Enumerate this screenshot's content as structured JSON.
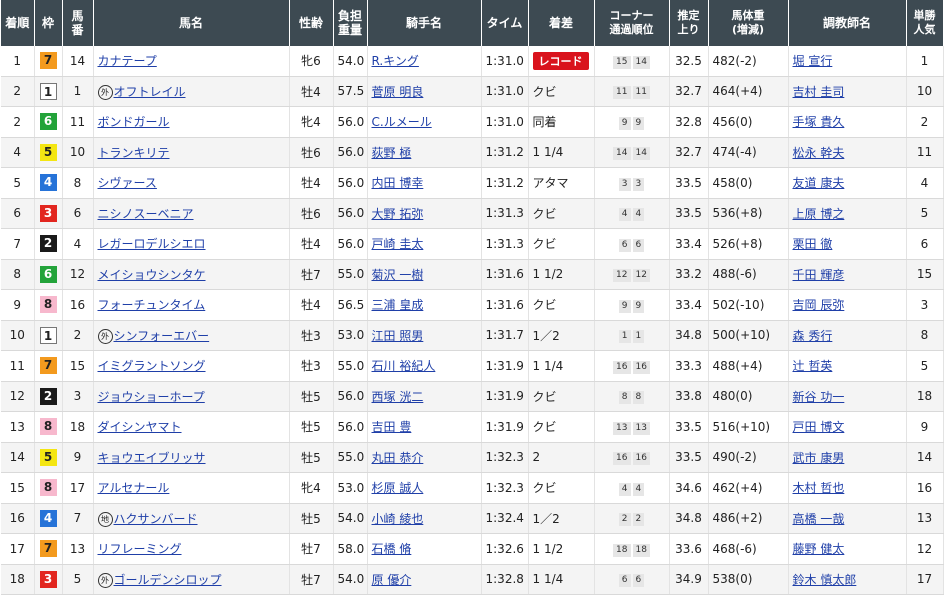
{
  "headers": {
    "rank": "着順",
    "waku": "枠",
    "umaban": "馬番",
    "horse": "馬名",
    "sexage": "性齢",
    "weight": "負担重量",
    "jockey": "騎手名",
    "time": "タイム",
    "margin": "着差",
    "corner": "コーナー通過順位",
    "last": "推定上り",
    "bodyweight": "馬体重(増減)",
    "trainer": "調教師名",
    "pop": "単勝人気"
  },
  "header_lines": {
    "umaban": [
      "馬",
      "番"
    ],
    "weight": [
      "負担",
      "重量"
    ],
    "corner": [
      "コーナー",
      "通過順位"
    ],
    "last": [
      "推定",
      "上り"
    ],
    "bodyweight": [
      "馬体重",
      "(増減)"
    ],
    "pop": [
      "単勝",
      "人気"
    ]
  },
  "colors": {
    "header_bg": "#3d4a52",
    "link": "#1f3fa8",
    "record_badge": "#d9131d"
  },
  "rows": [
    {
      "rank": "1",
      "waku": "7",
      "umaban": "14",
      "mark": "",
      "horse": "カナテープ",
      "sexage": "牝6",
      "weight": "54.0",
      "jockey": "R.キング",
      "time": "1:31.0",
      "margin": "",
      "badge": "レコード",
      "c1": "15",
      "c2": "14",
      "last": "32.5",
      "bw": "482",
      "chg": "(-2)",
      "trainer": "堀 宣行",
      "pop": "1"
    },
    {
      "rank": "2",
      "waku": "1",
      "umaban": "1",
      "mark": "外",
      "horse": "オフトレイル",
      "sexage": "牡4",
      "weight": "57.5",
      "jockey": "菅原 明良",
      "time": "1:31.0",
      "margin": "クビ",
      "badge": "",
      "c1": "11",
      "c2": "11",
      "last": "32.7",
      "bw": "464",
      "chg": "(+4)",
      "trainer": "吉村 圭司",
      "pop": "10"
    },
    {
      "rank": "2",
      "waku": "6",
      "umaban": "11",
      "mark": "",
      "horse": "ボンドガール",
      "sexage": "牝4",
      "weight": "56.0",
      "jockey": "C.ルメール",
      "time": "1:31.0",
      "margin": "同着",
      "badge": "",
      "c1": "9",
      "c2": "9",
      "last": "32.8",
      "bw": "456",
      "chg": "(0)",
      "trainer": "手塚 貴久",
      "pop": "2"
    },
    {
      "rank": "4",
      "waku": "5",
      "umaban": "10",
      "mark": "",
      "horse": "トランキリテ",
      "sexage": "牡6",
      "weight": "56.0",
      "jockey": "荻野 極",
      "time": "1:31.2",
      "margin": "1 1/4",
      "badge": "",
      "c1": "14",
      "c2": "14",
      "last": "32.7",
      "bw": "474",
      "chg": "(-4)",
      "trainer": "松永 幹夫",
      "pop": "11"
    },
    {
      "rank": "5",
      "waku": "4",
      "umaban": "8",
      "mark": "",
      "horse": "シヴァース",
      "sexage": "牡4",
      "weight": "56.0",
      "jockey": "内田 博幸",
      "time": "1:31.2",
      "margin": "アタマ",
      "badge": "",
      "c1": "3",
      "c2": "3",
      "last": "33.5",
      "bw": "458",
      "chg": "(0)",
      "trainer": "友道 康夫",
      "pop": "4"
    },
    {
      "rank": "6",
      "waku": "3",
      "umaban": "6",
      "mark": "",
      "horse": "ニシノスーベニア",
      "sexage": "牡6",
      "weight": "56.0",
      "jockey": "大野 拓弥",
      "time": "1:31.3",
      "margin": "クビ",
      "badge": "",
      "c1": "4",
      "c2": "4",
      "last": "33.5",
      "bw": "536",
      "chg": "(+8)",
      "trainer": "上原 博之",
      "pop": "5"
    },
    {
      "rank": "7",
      "waku": "2",
      "umaban": "4",
      "mark": "",
      "horse": "レガーロデルシエロ",
      "sexage": "牡4",
      "weight": "56.0",
      "jockey": "戸崎 圭太",
      "time": "1:31.3",
      "margin": "クビ",
      "badge": "",
      "c1": "6",
      "c2": "6",
      "last": "33.4",
      "bw": "526",
      "chg": "(+8)",
      "trainer": "栗田 徹",
      "pop": "6"
    },
    {
      "rank": "8",
      "waku": "6",
      "umaban": "12",
      "mark": "",
      "horse": "メイショウシンタケ",
      "sexage": "牡7",
      "weight": "55.0",
      "jockey": "菊沢 一樹",
      "time": "1:31.6",
      "margin": "1 1/2",
      "badge": "",
      "c1": "12",
      "c2": "12",
      "last": "33.2",
      "bw": "488",
      "chg": "(-6)",
      "trainer": "千田 輝彦",
      "pop": "15"
    },
    {
      "rank": "9",
      "waku": "8",
      "umaban": "16",
      "mark": "",
      "horse": "フォーチュンタイム",
      "sexage": "牡4",
      "weight": "56.5",
      "jockey": "三浦 皇成",
      "time": "1:31.6",
      "margin": "クビ",
      "badge": "",
      "c1": "9",
      "c2": "9",
      "last": "33.4",
      "bw": "502",
      "chg": "(-10)",
      "trainer": "吉岡 辰弥",
      "pop": "3"
    },
    {
      "rank": "10",
      "waku": "1",
      "umaban": "2",
      "mark": "外",
      "horse": "シンフォーエバー",
      "sexage": "牡3",
      "weight": "53.0",
      "jockey": "江田 照男",
      "time": "1:31.7",
      "margin": "1／2",
      "badge": "",
      "c1": "1",
      "c2": "1",
      "last": "34.8",
      "bw": "500",
      "chg": "(+10)",
      "trainer": "森 秀行",
      "pop": "8"
    },
    {
      "rank": "11",
      "waku": "7",
      "umaban": "15",
      "mark": "",
      "horse": "イミグラントソング",
      "sexage": "牡3",
      "weight": "55.0",
      "jockey": "石川 裕紀人",
      "time": "1:31.9",
      "margin": "1 1/4",
      "badge": "",
      "c1": "16",
      "c2": "16",
      "last": "33.3",
      "bw": "488",
      "chg": "(+4)",
      "trainer": "辻 哲英",
      "pop": "5"
    },
    {
      "rank": "12",
      "waku": "2",
      "umaban": "3",
      "mark": "",
      "horse": "ジョウショーホープ",
      "sexage": "牡5",
      "weight": "56.0",
      "jockey": "西塚 洸二",
      "time": "1:31.9",
      "margin": "クビ",
      "badge": "",
      "c1": "8",
      "c2": "8",
      "last": "33.8",
      "bw": "480",
      "chg": "(0)",
      "trainer": "新谷 功一",
      "pop": "18"
    },
    {
      "rank": "13",
      "waku": "8",
      "umaban": "18",
      "mark": "",
      "horse": "ダイシンヤマト",
      "sexage": "牡5",
      "weight": "56.0",
      "jockey": "吉田 豊",
      "time": "1:31.9",
      "margin": "クビ",
      "badge": "",
      "c1": "13",
      "c2": "13",
      "last": "33.5",
      "bw": "516",
      "chg": "(+10)",
      "trainer": "戸田 博文",
      "pop": "9"
    },
    {
      "rank": "14",
      "waku": "5",
      "umaban": "9",
      "mark": "",
      "horse": "キョウエイブリッサ",
      "sexage": "牡5",
      "weight": "55.0",
      "jockey": "丸田 恭介",
      "time": "1:32.3",
      "margin": "2",
      "badge": "",
      "c1": "16",
      "c2": "16",
      "last": "33.5",
      "bw": "490",
      "chg": "(-2)",
      "trainer": "武市 康男",
      "pop": "14"
    },
    {
      "rank": "15",
      "waku": "8",
      "umaban": "17",
      "mark": "",
      "horse": "アルセナール",
      "sexage": "牝4",
      "weight": "53.0",
      "jockey": "杉原 誠人",
      "time": "1:32.3",
      "margin": "クビ",
      "badge": "",
      "c1": "4",
      "c2": "4",
      "last": "34.6",
      "bw": "462",
      "chg": "(+4)",
      "trainer": "木村 哲也",
      "pop": "16"
    },
    {
      "rank": "16",
      "waku": "4",
      "umaban": "7",
      "mark": "地",
      "horse": "ハクサンバード",
      "sexage": "牡5",
      "weight": "54.0",
      "jockey": "小崎 綾也",
      "time": "1:32.4",
      "margin": "1／2",
      "badge": "",
      "c1": "2",
      "c2": "2",
      "last": "34.8",
      "bw": "486",
      "chg": "(+2)",
      "trainer": "高橋 一哉",
      "pop": "13"
    },
    {
      "rank": "17",
      "waku": "7",
      "umaban": "13",
      "mark": "",
      "horse": "リフレーミング",
      "sexage": "牡7",
      "weight": "58.0",
      "jockey": "石橋 脩",
      "time": "1:32.6",
      "margin": "1 1/2",
      "badge": "",
      "c1": "18",
      "c2": "18",
      "last": "33.6",
      "bw": "468",
      "chg": "(-6)",
      "trainer": "藤野 健太",
      "pop": "12"
    },
    {
      "rank": "18",
      "waku": "3",
      "umaban": "5",
      "mark": "外",
      "horse": "ゴールデンシロップ",
      "sexage": "牡7",
      "weight": "54.0",
      "jockey": "原 優介",
      "time": "1:32.8",
      "margin": "1 1/4",
      "badge": "",
      "c1": "6",
      "c2": "6",
      "last": "34.9",
      "bw": "538",
      "chg": "(0)",
      "trainer": "鈴木 慎太郎",
      "pop": "17"
    }
  ]
}
